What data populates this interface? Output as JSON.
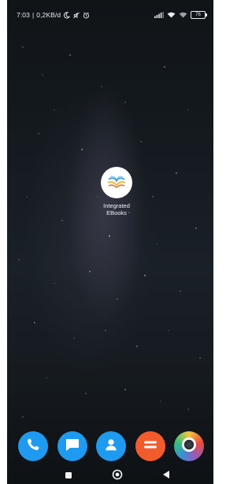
{
  "status_bar": {
    "time": "7:03",
    "separator": "|",
    "net_speed": "0,2KB/d",
    "battery": "76",
    "icons_left": [
      "moon-icon",
      "mute-icon",
      "alarm-icon"
    ],
    "icons_right": [
      "signal-icon",
      "wifi-icon",
      "wifi-icon-2",
      "battery-icon"
    ]
  },
  "home": {
    "apps": [
      {
        "label": "Integrated\nEBooks",
        "label_line1": "Integrated",
        "label_line2": "EBooks",
        "icon": "integrated-ebooks-icon"
      }
    ]
  },
  "dock": {
    "apps": [
      {
        "icon": "phone-icon",
        "color": "#1e9bf0"
      },
      {
        "icon": "messages-icon",
        "color": "#1e9bf0"
      },
      {
        "icon": "contacts-icon",
        "color": "#1e9bf0"
      },
      {
        "icon": "calculator-icon",
        "color": "#f25c2d"
      },
      {
        "icon": "camera-icon",
        "color": "#ffffff"
      }
    ]
  },
  "navbar": {
    "buttons": [
      "recents-button",
      "home-button",
      "back-button"
    ]
  },
  "colors": {
    "wallpaper_dark": "#121619",
    "accent_blue": "#1e9bf0",
    "accent_orange": "#f25c2d"
  }
}
